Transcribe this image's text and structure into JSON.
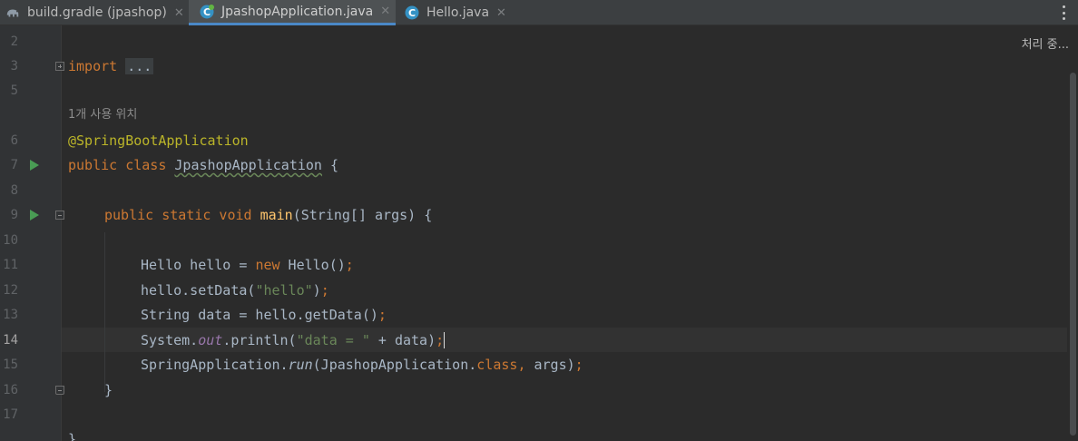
{
  "tabs": [
    {
      "label": "build.gradle (jpashop)",
      "icon": "gradle-elephant-icon"
    },
    {
      "label": "JpashopApplication.java",
      "icon": "spring-class-icon",
      "active": true
    },
    {
      "label": "Hello.java",
      "icon": "class-icon"
    }
  ],
  "status": "처리 중...",
  "editor": {
    "usage_hint": "1개 사용 위치",
    "lines": [
      {
        "n": "2"
      },
      {
        "n": "3",
        "t1": "import",
        "t2": " ",
        "t3": "..."
      },
      {
        "n": "5"
      },
      {
        "n": "6",
        "t1": "@SpringBootApplication"
      },
      {
        "n": "7",
        "t1": "public class",
        "t2": " ",
        "t3": "JpashopApplication",
        "t4": " {"
      },
      {
        "n": "8"
      },
      {
        "n": "9",
        "t1": "public static void",
        "t2": " ",
        "t3": "main",
        "t4": "(String[] args) {"
      },
      {
        "n": "10"
      },
      {
        "n": "11",
        "t1": "Hello hello = ",
        "t2": "new",
        "t3": " Hello()",
        "t4": ";"
      },
      {
        "n": "12",
        "t1": "hello.setData(",
        "t2": "\"hello\"",
        "t3": ")",
        "t4": ";"
      },
      {
        "n": "13",
        "t1": "String data = hello.getData()",
        "t2": ";"
      },
      {
        "n": "14",
        "t1": "System.",
        "t2": "out",
        "t3": ".println(",
        "t4": "\"data = \"",
        "t5": " + data)",
        "t6": ";"
      },
      {
        "n": "15",
        "t1": "SpringApplication.",
        "t2": "run",
        "t3": "(JpashopApplication.",
        "t4": "class",
        "t5": ",",
        "t6": " args)",
        "t7": ";"
      },
      {
        "n": "16",
        "t1": "}"
      },
      {
        "n": "17"
      },
      {
        "t1": "}"
      }
    ]
  },
  "colors": {
    "background": "#2b2b2b",
    "keyword": "#cc7832",
    "annotation": "#bbb529",
    "string": "#6a8759",
    "function": "#ffc66d",
    "static_field": "#9876aa",
    "run_gutter": "#499c54",
    "active_tab_underline": "#4a88c7"
  }
}
